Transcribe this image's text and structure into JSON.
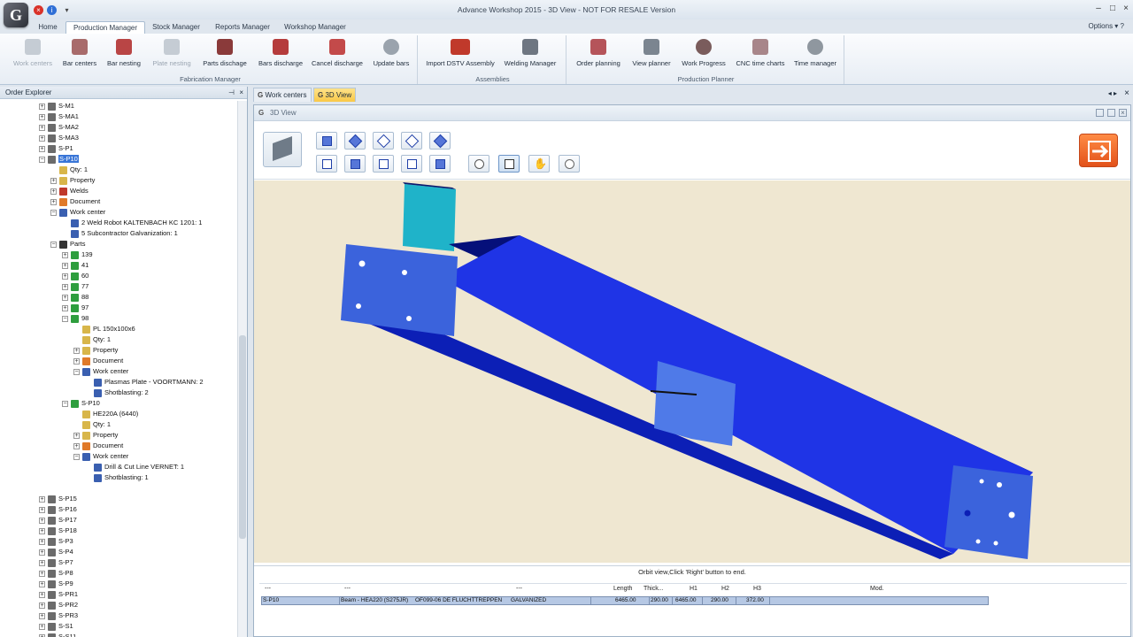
{
  "window": {
    "logo_text": "G",
    "title": "Advance Workshop 2015 - 3D View - NOT FOR RESALE Version"
  },
  "ribbon_tabs": [
    "Home",
    "Production Manager",
    "Stock Manager",
    "Reports Manager",
    "Workshop Manager"
  ],
  "options_label": "Options",
  "ribbon": {
    "fabrication": {
      "label": "Fabrication Manager",
      "buttons": [
        "Work centers",
        "Bar centers",
        "Bar nesting",
        "Plate nesting",
        "Parts dischage",
        "Bars discharge",
        "Cancel discharge",
        "Update bars"
      ]
    },
    "assemblies": {
      "label": "Assemblies",
      "buttons": [
        "Import DSTV Assembly",
        "Welding Manager"
      ]
    },
    "planner": {
      "label": "Production Planner",
      "buttons": [
        "Order planning",
        "View planner",
        "Work Progress",
        "CNC time charts",
        "Time manager"
      ]
    }
  },
  "explorer": {
    "title": "Order Explorer",
    "nodes": [
      "S-M1",
      "S-MA1",
      "S-MA2",
      "S-MA3",
      "S-P1",
      "S-P10",
      "Qty: 1",
      "Property",
      "Welds",
      "Document",
      "Work center",
      "2 Weld Robot KALTENBACH KC 1201: 1",
      "5 Subcontractor Galvanization: 1",
      "Parts",
      "139",
      "41",
      "60",
      "77",
      "88",
      "97",
      "98",
      "PL 150x100x6",
      "Qty: 1",
      "Property",
      "Document",
      "Work center",
      "Plasmas Plate - VOORTMANN: 2",
      "Shotblasting: 2",
      "S-P10",
      "HE220A (6440)",
      "Qty: 1",
      "Property",
      "Document",
      "Work center",
      "Drill & Cut Line VERNET: 1",
      "Shotblasting: 1",
      "S-P15",
      "S-P16",
      "S-P17",
      "S-P18",
      "S-P3",
      "S-P4",
      "S-P7",
      "S-P8",
      "S-P9",
      "S-PR1",
      "S-PR2",
      "S-PR3",
      "S-S1",
      "S-S11",
      "S-S15"
    ]
  },
  "doc_tabs": [
    "Work centers",
    "3D View"
  ],
  "pane_title": "3D View",
  "status_message": "Orbit view,Click 'Right' button to end.",
  "grid": {
    "headers": [
      "---",
      "---",
      "---",
      "Length",
      "Thick...",
      "H1",
      "H2",
      "H3",
      "Mod."
    ],
    "row": [
      "S-P10",
      "Beam - HEA220 (S275JR)",
      "OF099-06 DE FLUCHTTREPPEN",
      "GALVANIZED",
      "6465.00",
      "290.00",
      "6465.00",
      "290.00",
      "372.00"
    ]
  },
  "colors": {
    "beam_blue": "#1f34e6",
    "plate_blue": "#3b63dc",
    "cyan_part": "#1fb3c9",
    "viewport_bg": "#efe7d1",
    "selection": "#3875d7"
  }
}
